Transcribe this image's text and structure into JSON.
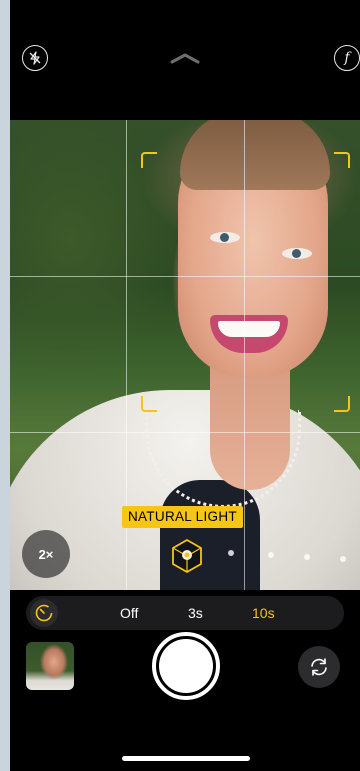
{
  "top_bar": {
    "flash_icon": "flash-off-icon",
    "chevron_icon": "chevron-up-icon",
    "aperture_symbol": "f"
  },
  "viewfinder": {
    "lighting_mode": "NATURAL LIGHT",
    "zoom": "2×",
    "accent_color": "#f5c518"
  },
  "timer": {
    "icon": "timer-icon",
    "options": [
      "Off",
      "3s",
      "10s"
    ],
    "selected": "10s"
  },
  "controls": {
    "thumbnail_icon": "photo-thumbnail",
    "shutter_icon": "shutter-button",
    "flip_icon": "camera-flip-icon"
  }
}
